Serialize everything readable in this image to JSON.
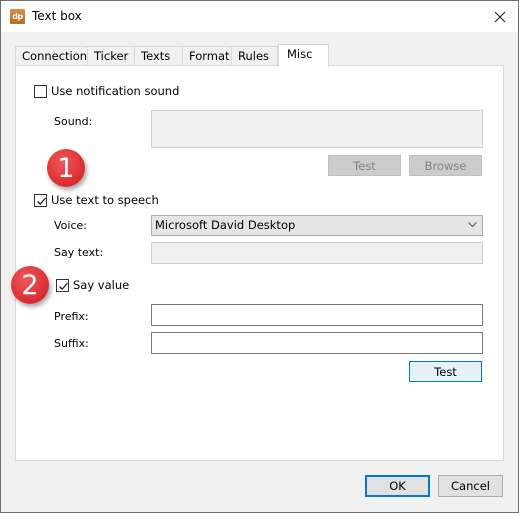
{
  "window": {
    "title": "Text box",
    "app_icon_text": "dp",
    "close_icon": "close-icon"
  },
  "tabs": [
    {
      "label": "Connection",
      "active": false
    },
    {
      "label": "Ticker",
      "active": false
    },
    {
      "label": "Texts",
      "active": false
    },
    {
      "label": "Format",
      "active": false
    },
    {
      "label": "Rules",
      "active": false
    },
    {
      "label": "Misc",
      "active": true
    }
  ],
  "misc": {
    "notification": {
      "checkbox_label": "Use notification sound",
      "checked": false,
      "sound_label": "Sound:",
      "sound_value": "",
      "test_label": "Test",
      "browse_label": "Browse"
    },
    "tts": {
      "checkbox_label": "Use text to speech",
      "checked": true,
      "voice_label": "Voice:",
      "voice_value": "Microsoft David Desktop",
      "say_text_label": "Say text:",
      "say_text_value": "",
      "say_value_label": "Say value",
      "say_value_checked": true,
      "prefix_label": "Prefix:",
      "prefix_value": "",
      "suffix_label": "Suffix:",
      "suffix_value": "",
      "test_label": "Test"
    }
  },
  "annotations": [
    {
      "number": "1",
      "color": "#e03a3d"
    },
    {
      "number": "2",
      "color": "#e03a3d"
    }
  ],
  "footer": {
    "ok_label": "OK",
    "cancel_label": "Cancel"
  }
}
